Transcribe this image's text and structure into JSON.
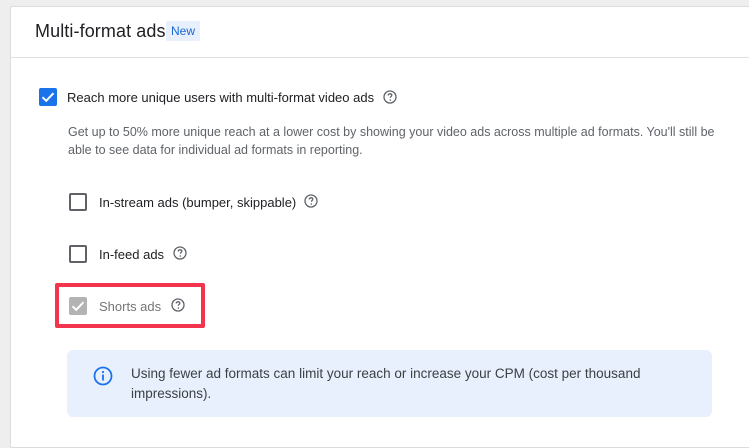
{
  "section": {
    "title": "Multi-format ads",
    "badge": "New"
  },
  "main_option": {
    "label": "Reach more unique users with multi-format video ads",
    "checked": true,
    "description": "Get up to 50% more unique reach at a lower cost by showing your video ads across multiple ad formats. You'll still be able to see data for individual ad formats in reporting."
  },
  "formats": [
    {
      "label": "In-stream ads (bumper, skippable)",
      "checked": false,
      "disabled": false
    },
    {
      "label": "In-feed ads",
      "checked": false,
      "disabled": false
    },
    {
      "label": "Shorts ads",
      "checked": true,
      "disabled": true
    }
  ],
  "info": {
    "text": "Using fewer ad formats can limit your reach or increase your CPM (cost per thousand impressions)."
  },
  "colors": {
    "accent": "#1a73e8",
    "highlight": "#f2344c",
    "info_bg": "#e8f0fe"
  }
}
